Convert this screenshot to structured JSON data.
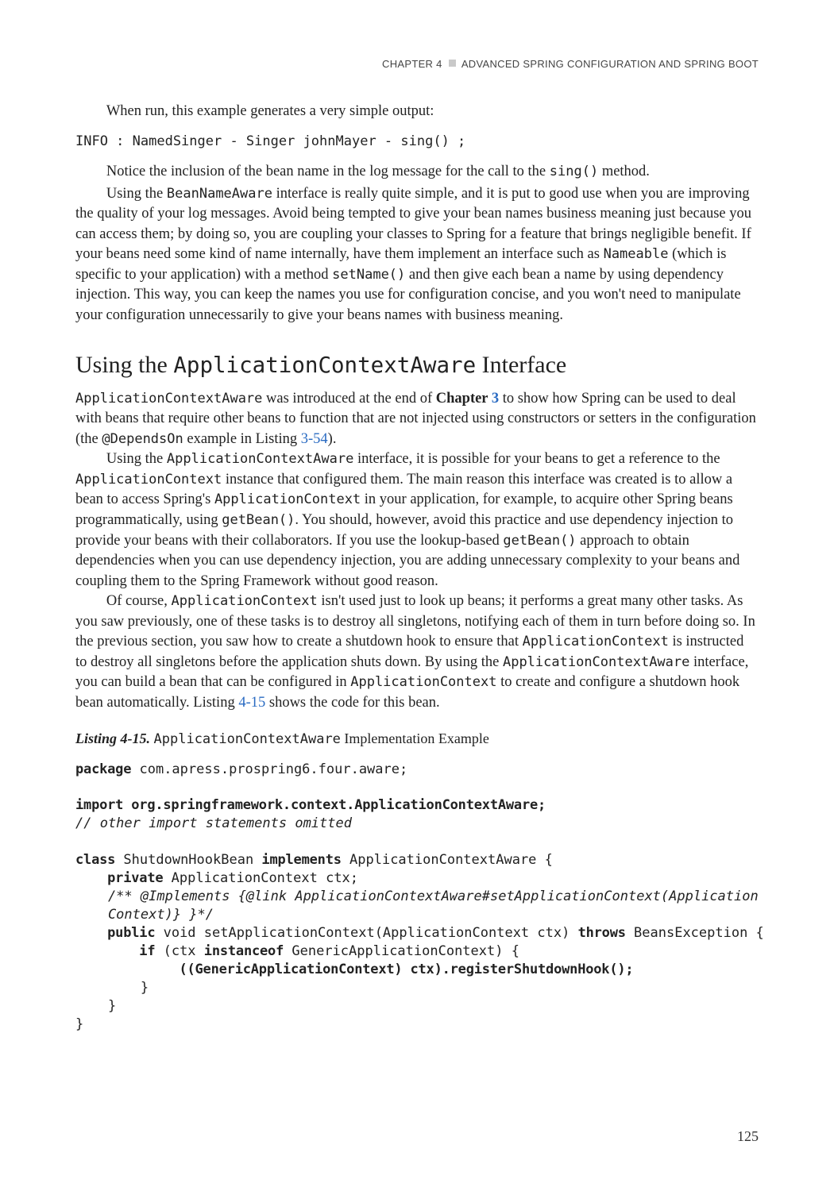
{
  "header": {
    "chapter_label": "CHAPTER 4",
    "chapter_title": "ADVANCED SPRING CONFIGURATION AND SPRING BOOT"
  },
  "p1": "When run, this example generates a very simple output:",
  "code1": "INFO : NamedSinger - Singer johnMayer - sing() ;",
  "p2a": "Notice the inclusion of the bean name in the log message for the call to the ",
  "p2b": "sing()",
  "p2c": " method.",
  "p3a": "Using the ",
  "p3b": "BeanNameAware",
  "p3c": " interface is really quite simple, and it is put to good use when you are improving the quality of your log messages. Avoid being tempted to give your bean names business meaning just because you can access them; by doing so, you are coupling your classes to Spring for a feature that brings negligible benefit. If your beans need some kind of name internally, have them implement an interface such as ",
  "p3d": "Nameable",
  "p3e": " (which is specific to your application) with a method ",
  "p3f": "setName()",
  "p3g": " and then give each bean a name by using dependency injection. This way, you can keep the names you use for configuration concise, and you won't need to manipulate your configuration unnecessarily to give your beans names with business meaning.",
  "h2a": "Using the ",
  "h2b": "ApplicationContextAware",
  "h2c": " Interface",
  "s2p1a": "ApplicationContextAware",
  "s2p1b": " was introduced at the end of ",
  "s2p1c": "Chapter ",
  "s2p1d": "3",
  "s2p1e": " to show how Spring can be used to deal with beans that require other beans to function that are not injected using constructors or setters in the configuration (the ",
  "s2p1f": "@DependsOn",
  "s2p1g": " example in Listing ",
  "s2p1h": "3-54",
  "s2p1i": ").",
  "s2p2a": "Using the ",
  "s2p2b": "ApplicationContextAware",
  "s2p2c": " interface, it is possible for your beans to get a reference to the ",
  "s2p2d": "ApplicationContext",
  "s2p2e": " instance that configured them. The main reason this interface was created is to allow a bean to access Spring's ",
  "s2p2f": "ApplicationContext",
  "s2p2g": " in your application, for example, to acquire other Spring beans programmatically, using ",
  "s2p2h": "getBean()",
  "s2p2i": ". You should, however, avoid this practice and use dependency injection to provide your beans with their collaborators. If you use the lookup-based ",
  "s2p2j": "getBean()",
  "s2p2k": " approach to obtain dependencies when you can use dependency injection, you are adding unnecessary complexity to your beans and coupling them to the Spring Framework without good reason.",
  "s2p3a": "Of course, ",
  "s2p3b": "ApplicationContext",
  "s2p3c": " isn't used just to look up beans; it performs a great many other tasks. As you saw previously, one of these tasks is to destroy all singletons, notifying each of them in turn before doing so. In the previous section, you saw how to create a shutdown hook to ensure that ",
  "s2p3d": "ApplicationContext",
  "s2p3e": " is instructed to destroy all singletons before the application shuts down. By using the ",
  "s2p3f": "ApplicationContextAware",
  "s2p3g": " interface, you can build a bean that can be configured in ",
  "s2p3h": "ApplicationContext",
  "s2p3i": " to create and configure a shutdown hook bean automatically. Listing ",
  "s2p3j": "4-15",
  "s2p3k": " shows the code for this bean.",
  "listing_num": "Listing 4-15.",
  "listing_title_a": "ApplicationContextAware",
  "listing_title_b": " Implementation Example",
  "code2": {
    "l1a": "package",
    "l1b": " com.apress.prospring6.four.aware;",
    "l2a": "import org.springframework.context.ApplicationContextAware;",
    "l3": "// other import statements omitted",
    "l4a": "class",
    "l4b": " ShutdownHookBean ",
    "l4c": "implements",
    "l4d": " ApplicationContextAware {",
    "l5a": "    private",
    "l5b": " ApplicationContext ctx;",
    "l6": "    /** @Implements {@link ApplicationContextAware#setApplicationContext(Application",
    "l6b": "    Context)} }*/",
    "l7a": "    public",
    "l7b": " void setApplicationContext(ApplicationContext ctx) ",
    "l7c": "throws",
    "l7d": " BeansException {",
    "l8a": "        if",
    "l8b": " (ctx ",
    "l8c": "instanceof",
    "l8d": " GenericApplicationContext) {",
    "l9": "             ((GenericApplicationContext) ctx).registerShutdownHook();",
    "l10": "        }",
    "l11": "    }",
    "l12": "}"
  },
  "pagenum": "125"
}
